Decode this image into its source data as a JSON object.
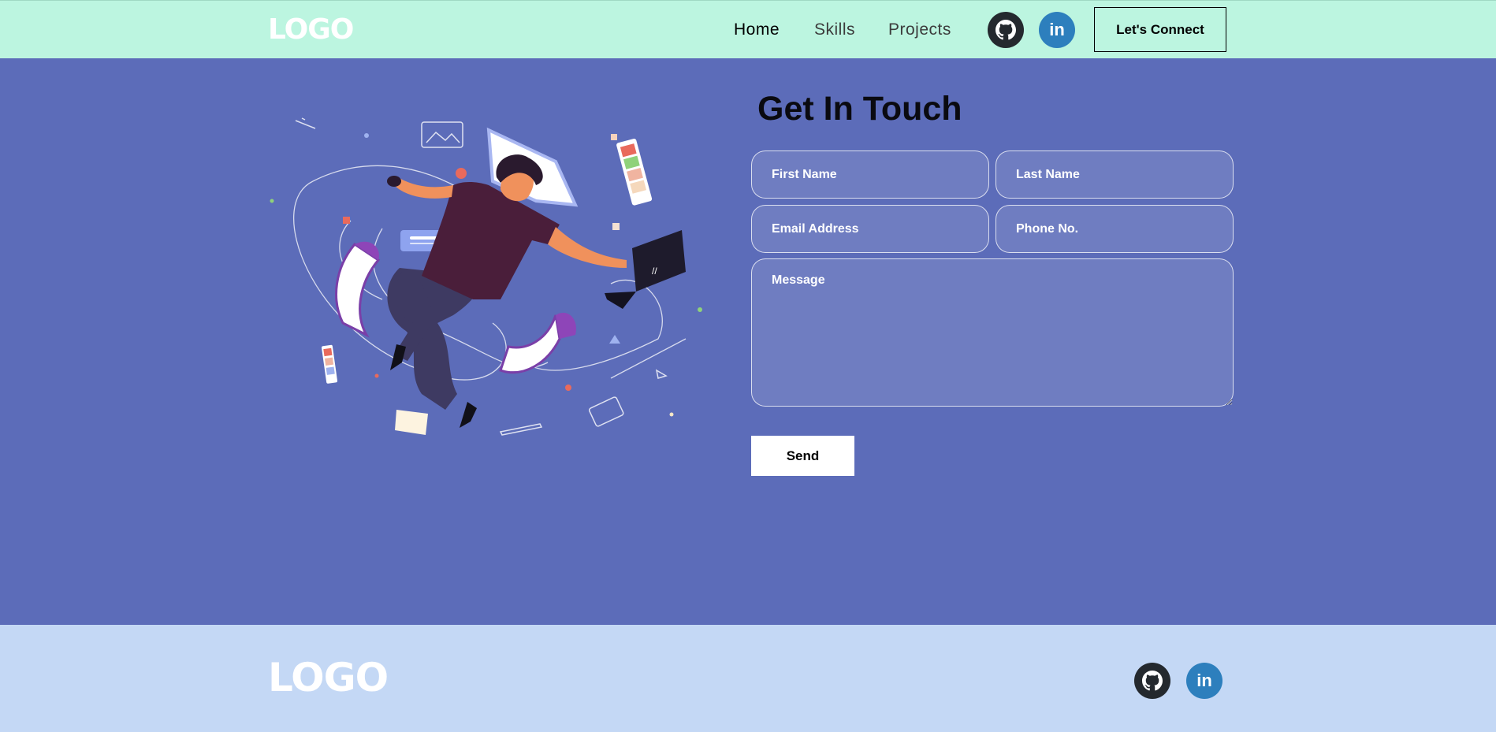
{
  "navbar": {
    "logo": "LOGO",
    "links": [
      "Home",
      "Skills",
      "Projects"
    ],
    "active_link": "Home",
    "social_icons": [
      "github-icon",
      "linkedin-icon"
    ],
    "linkedin_text": "in",
    "connect_label": "Let's Connect"
  },
  "contact": {
    "title": "Get In Touch",
    "fields": {
      "first_name": {
        "placeholder": "First Name",
        "value": ""
      },
      "last_name": {
        "placeholder": "Last Name",
        "value": ""
      },
      "email": {
        "placeholder": "Email Address",
        "value": ""
      },
      "phone": {
        "placeholder": "Phone No.",
        "value": ""
      },
      "message": {
        "placeholder": "Message",
        "value": ""
      }
    },
    "send_label": "Send",
    "illustration": {
      "laptop_text": "//"
    }
  },
  "footer": {
    "logo": "LOGO",
    "social_icons": [
      "github-icon",
      "linkedin-icon"
    ],
    "linkedin_text": "in"
  },
  "colors": {
    "navbar_bg": "#bcf5e0",
    "main_bg": "#5c6cb9",
    "footer_bg": "#c4d8f5",
    "github_bg": "#24292e",
    "linkedin_bg": "#2d7fbd",
    "button_bg": "#ffffff"
  }
}
